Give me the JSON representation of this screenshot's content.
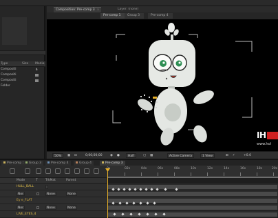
{
  "comp_window": {
    "tab_label": "Composition: Pre-comp 3",
    "layer_window_label": "Layer: (none)"
  },
  "project_panel": {
    "header": {
      "name": "Type",
      "size": "Size",
      "media": "Media"
    },
    "rows": [
      {
        "name": "Compositi",
        "icon": "flowchart-icon"
      },
      {
        "name": "Compositi",
        "icon": "composition-icon"
      },
      {
        "name": "Compositi",
        "icon": "composition-icon"
      },
      {
        "name": "Folder",
        "icon": "folder-icon"
      }
    ]
  },
  "comp_flow": [
    "Pre-comp 1",
    "Group 3",
    "Pre-comp 4"
  ],
  "comp_controls": {
    "zoom": "50%",
    "timecode": "0;00;00;00",
    "resolution": "Half",
    "camera": "Active Camera",
    "views": "1 View",
    "exposure": "+0.0"
  },
  "logo": {
    "main": "IH",
    "url": "www.hol"
  },
  "timeline_tabs": [
    {
      "label": "Pre-comp 1",
      "color": "#c9b15a",
      "active": false
    },
    {
      "label": "Group 3",
      "color": "#8fa86b",
      "active": false
    },
    {
      "label": "Pre-comp 4",
      "color": "#6d8fb5",
      "active": false
    },
    {
      "label": "Group 4",
      "color": "#b57f5a",
      "active": false
    },
    {
      "label": "Pre-comp 3",
      "color": "#c9b15a",
      "active": true
    }
  ],
  "timeline_header": {
    "mode": "Mode",
    "trkmat": "TrkMat",
    "parent": "Parent",
    "t": "T"
  },
  "time_ruler": [
    "0s",
    "02s",
    "04s",
    "06s",
    "08s",
    "10s",
    "12s",
    "14s",
    "16s",
    "18s",
    "20s"
  ],
  "layers": [
    {
      "name": "HULL_BALL",
      "mode": "Nor",
      "trkmat": "",
      "parent": "",
      "has_keys": true
    },
    {
      "name": "",
      "mode": "Nor",
      "trkmat": "None",
      "parent": "None",
      "has_keys": false
    },
    {
      "name": "Ey e_FLAT",
      "mode": "Nor",
      "trkmat": "None",
      "parent": "None",
      "has_keys": true
    },
    {
      "name": "",
      "mode": "Nor",
      "trkmat": "None",
      "parent": "None",
      "has_keys": false
    },
    {
      "name": "LIVE_EYES_4",
      "mode": "Nor",
      "trkmat": "None",
      "parent": "None",
      "has_keys": true
    },
    {
      "name": "",
      "mode": "Nor",
      "trkmat": "None",
      "parent": "None",
      "has_keys": false
    }
  ],
  "colors": {
    "playhead": "#e8b028",
    "layer_name": "#e8c44a",
    "robot_body": "#e9ece8",
    "robot_eye": "#2f8f54"
  }
}
